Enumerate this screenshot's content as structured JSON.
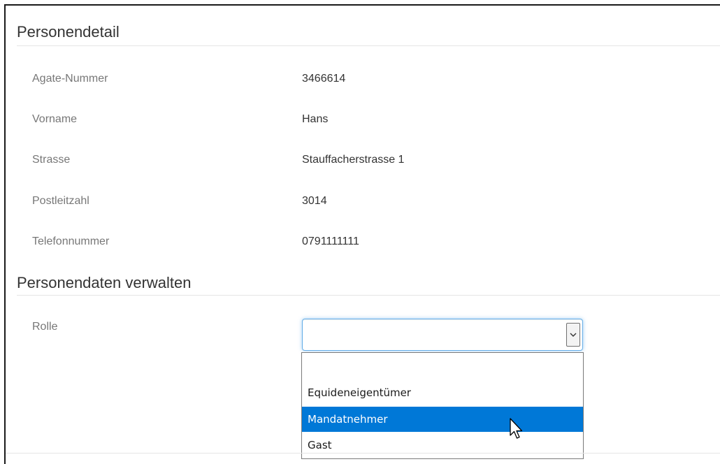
{
  "personendetail": {
    "title": "Personendetail",
    "fields": [
      {
        "label": "Agate-Nummer",
        "value": "3466614"
      },
      {
        "label": "Vorname",
        "value": "Hans"
      },
      {
        "label": "Strasse",
        "value": "Stauffacherstrasse 1"
      },
      {
        "label": "Postleitzahl",
        "value": "3014"
      },
      {
        "label": "Telefonnummer",
        "value": "0791111111"
      }
    ]
  },
  "verwalten": {
    "title": "Personendaten verwalten",
    "rolle_label": "Rolle",
    "rolle_value": "",
    "options": [
      "",
      "Equideneigentümer",
      "Mandatnehmer",
      "Gast"
    ],
    "highlighted_option": "Mandatnehmer"
  },
  "colors": {
    "focus_border": "#66afe9",
    "highlight": "#0078d7",
    "label": "#777777"
  },
  "icons": {
    "dropdown": "chevron-down-icon",
    "cursor": "mouse-pointer-icon"
  }
}
